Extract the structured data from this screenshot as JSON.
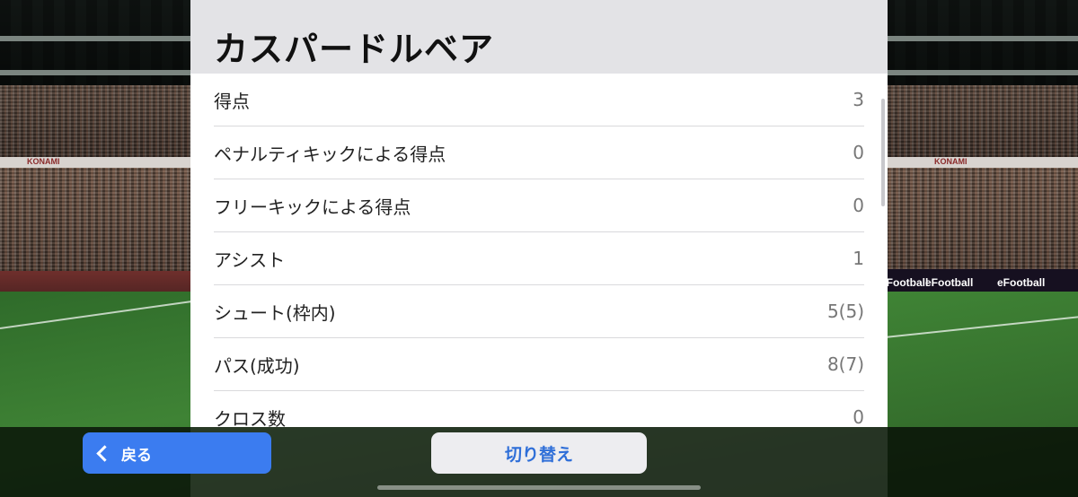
{
  "player": {
    "name": "カスパードルベア"
  },
  "stats": [
    {
      "label": "得点",
      "value": "3"
    },
    {
      "label": "ペナルティキックによる得点",
      "value": "0"
    },
    {
      "label": "フリーキックによる得点",
      "value": "0"
    },
    {
      "label": "アシスト",
      "value": "1"
    },
    {
      "label": "シュート(枠内)",
      "value": "5(5)"
    },
    {
      "label": "パス(成功)",
      "value": "8(7)"
    },
    {
      "label": "クロス数",
      "value": "0"
    }
  ],
  "background": {
    "ads": [
      "KONAMI",
      "eFootball"
    ]
  },
  "footer": {
    "back_label": "戻る",
    "switch_label": "切り替え"
  },
  "colors": {
    "primary_button": "#3b7cf0",
    "secondary_button_text": "#2f6fd8",
    "header_bg": "#e3e3e6"
  }
}
